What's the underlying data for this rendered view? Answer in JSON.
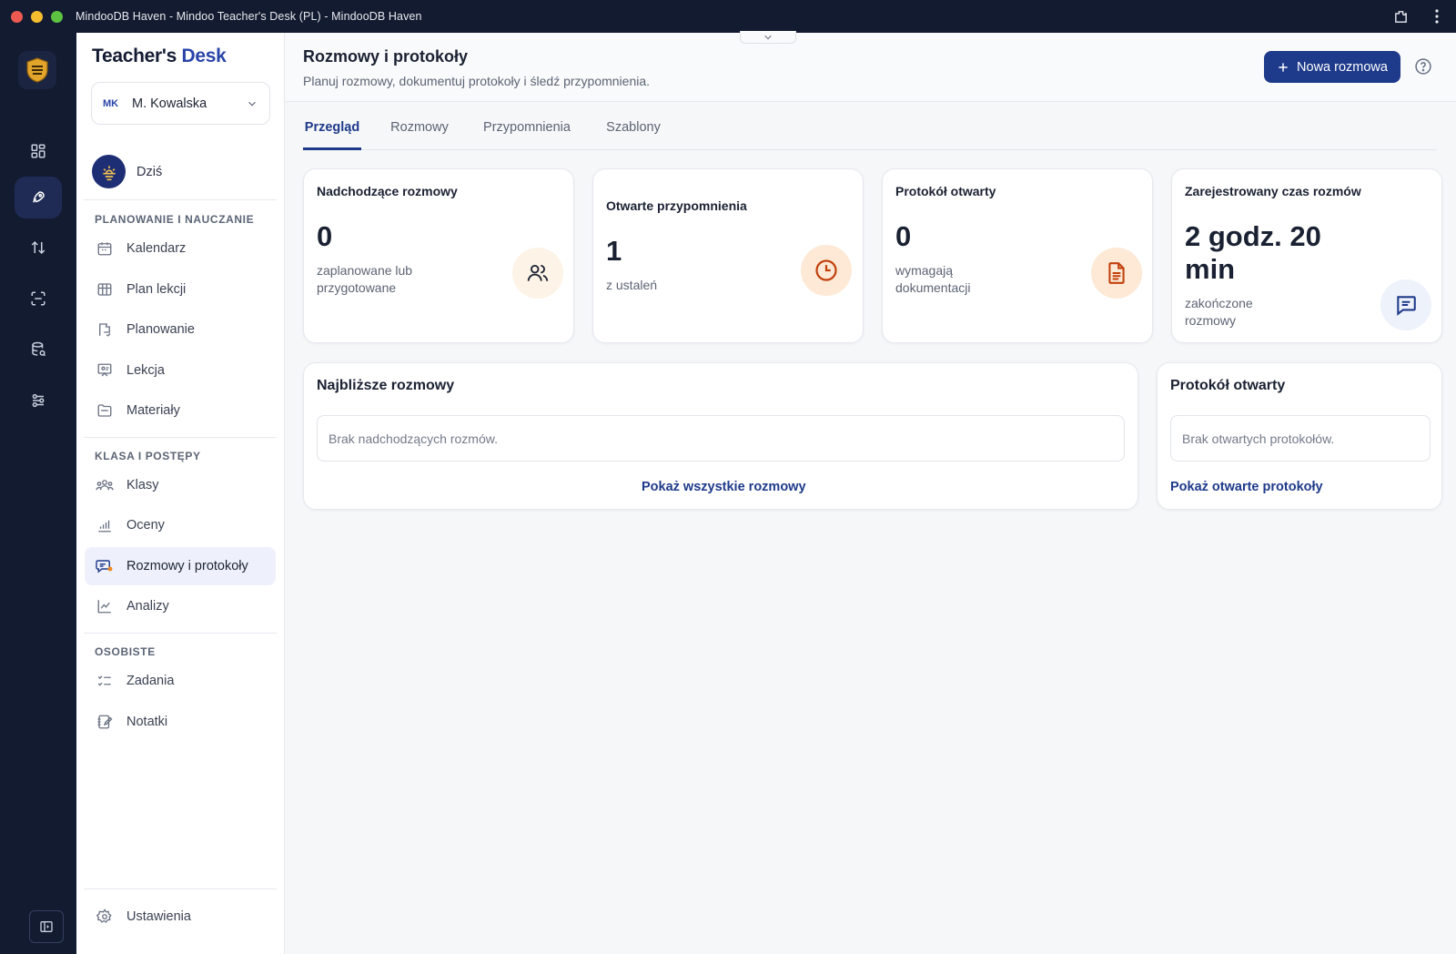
{
  "window": {
    "title": "MindooDB Haven - Mindoo Teacher's Desk (PL) - MindooDB Haven"
  },
  "rail": {
    "items": [
      "dashboard-icon",
      "rocket-icon",
      "sync-icon",
      "scan-icon",
      "database-search-icon",
      "settings-sliders-icon"
    ],
    "active": "rocket-icon"
  },
  "sidebar": {
    "brand_main": "Teacher's",
    "brand_accent": "Desk",
    "user": {
      "initials": "MK",
      "name": "M. Kowalska"
    },
    "today_label": "Dziś",
    "sections": {
      "planning": "PLANOWANIE I NAUCZANIE",
      "class": "KLASA I POSTĘPY",
      "personal": "OSOBISTE"
    },
    "items": {
      "calendar": "Kalendarz",
      "lesson_plan": "Plan lekcji",
      "planning": "Planowanie",
      "lesson": "Lekcja",
      "materials": "Materiały",
      "classes": "Klasy",
      "grades": "Oceny",
      "conversations": "Rozmowy i protokoły",
      "analytics": "Analizy",
      "tasks": "Zadania",
      "notes": "Notatki",
      "settings": "Ustawienia"
    }
  },
  "header": {
    "title": "Rozmowy i protokoły",
    "subtitle": "Planuj rozmowy, dokumentuj protokoły i śledź przypomnienia.",
    "new_button": "Nowa rozmowa"
  },
  "tabs": [
    "Przegląd",
    "Rozmowy",
    "Przypomnienia",
    "Szablony"
  ],
  "active_tab": "Przegląd",
  "stats": [
    {
      "title": "Nadchodzące rozmowy",
      "value": "0",
      "sub1": "zaplanowane lub",
      "sub2": "przygotowane",
      "icon": "users-icon"
    },
    {
      "title": "Otwarte przypomnienia",
      "value": "1",
      "sub1": "z ustaleń",
      "icon": "clock-icon"
    },
    {
      "title": "Protokół otwarty",
      "value": "0",
      "sub1": "wymagają",
      "sub2": "dokumentacji",
      "icon": "document-icon"
    },
    {
      "title": "Zarejestrowany czas rozmów",
      "value1": "2 godz. 20",
      "value2": "min",
      "sub1": "zakończone",
      "sub2": "rozmowy",
      "icon": "message-icon"
    }
  ],
  "panels": {
    "upcoming": {
      "title": "Najbliższe rozmowy",
      "empty": "Brak nadchodzących rozmów.",
      "link": "Pokaż wszystkie rozmowy"
    },
    "open_protocols": {
      "title": "Protokół otwarty",
      "empty": "Brak otwartych protokołów.",
      "link": "Pokaż otwarte protokoły"
    }
  },
  "colors": {
    "primary": "#1e3a8a",
    "rail_bg": "#131b31",
    "accent_orange": "#c2410c",
    "accent_orange_bg": "#fdf1e4",
    "accent_blue_bg": "#eef2fb"
  }
}
